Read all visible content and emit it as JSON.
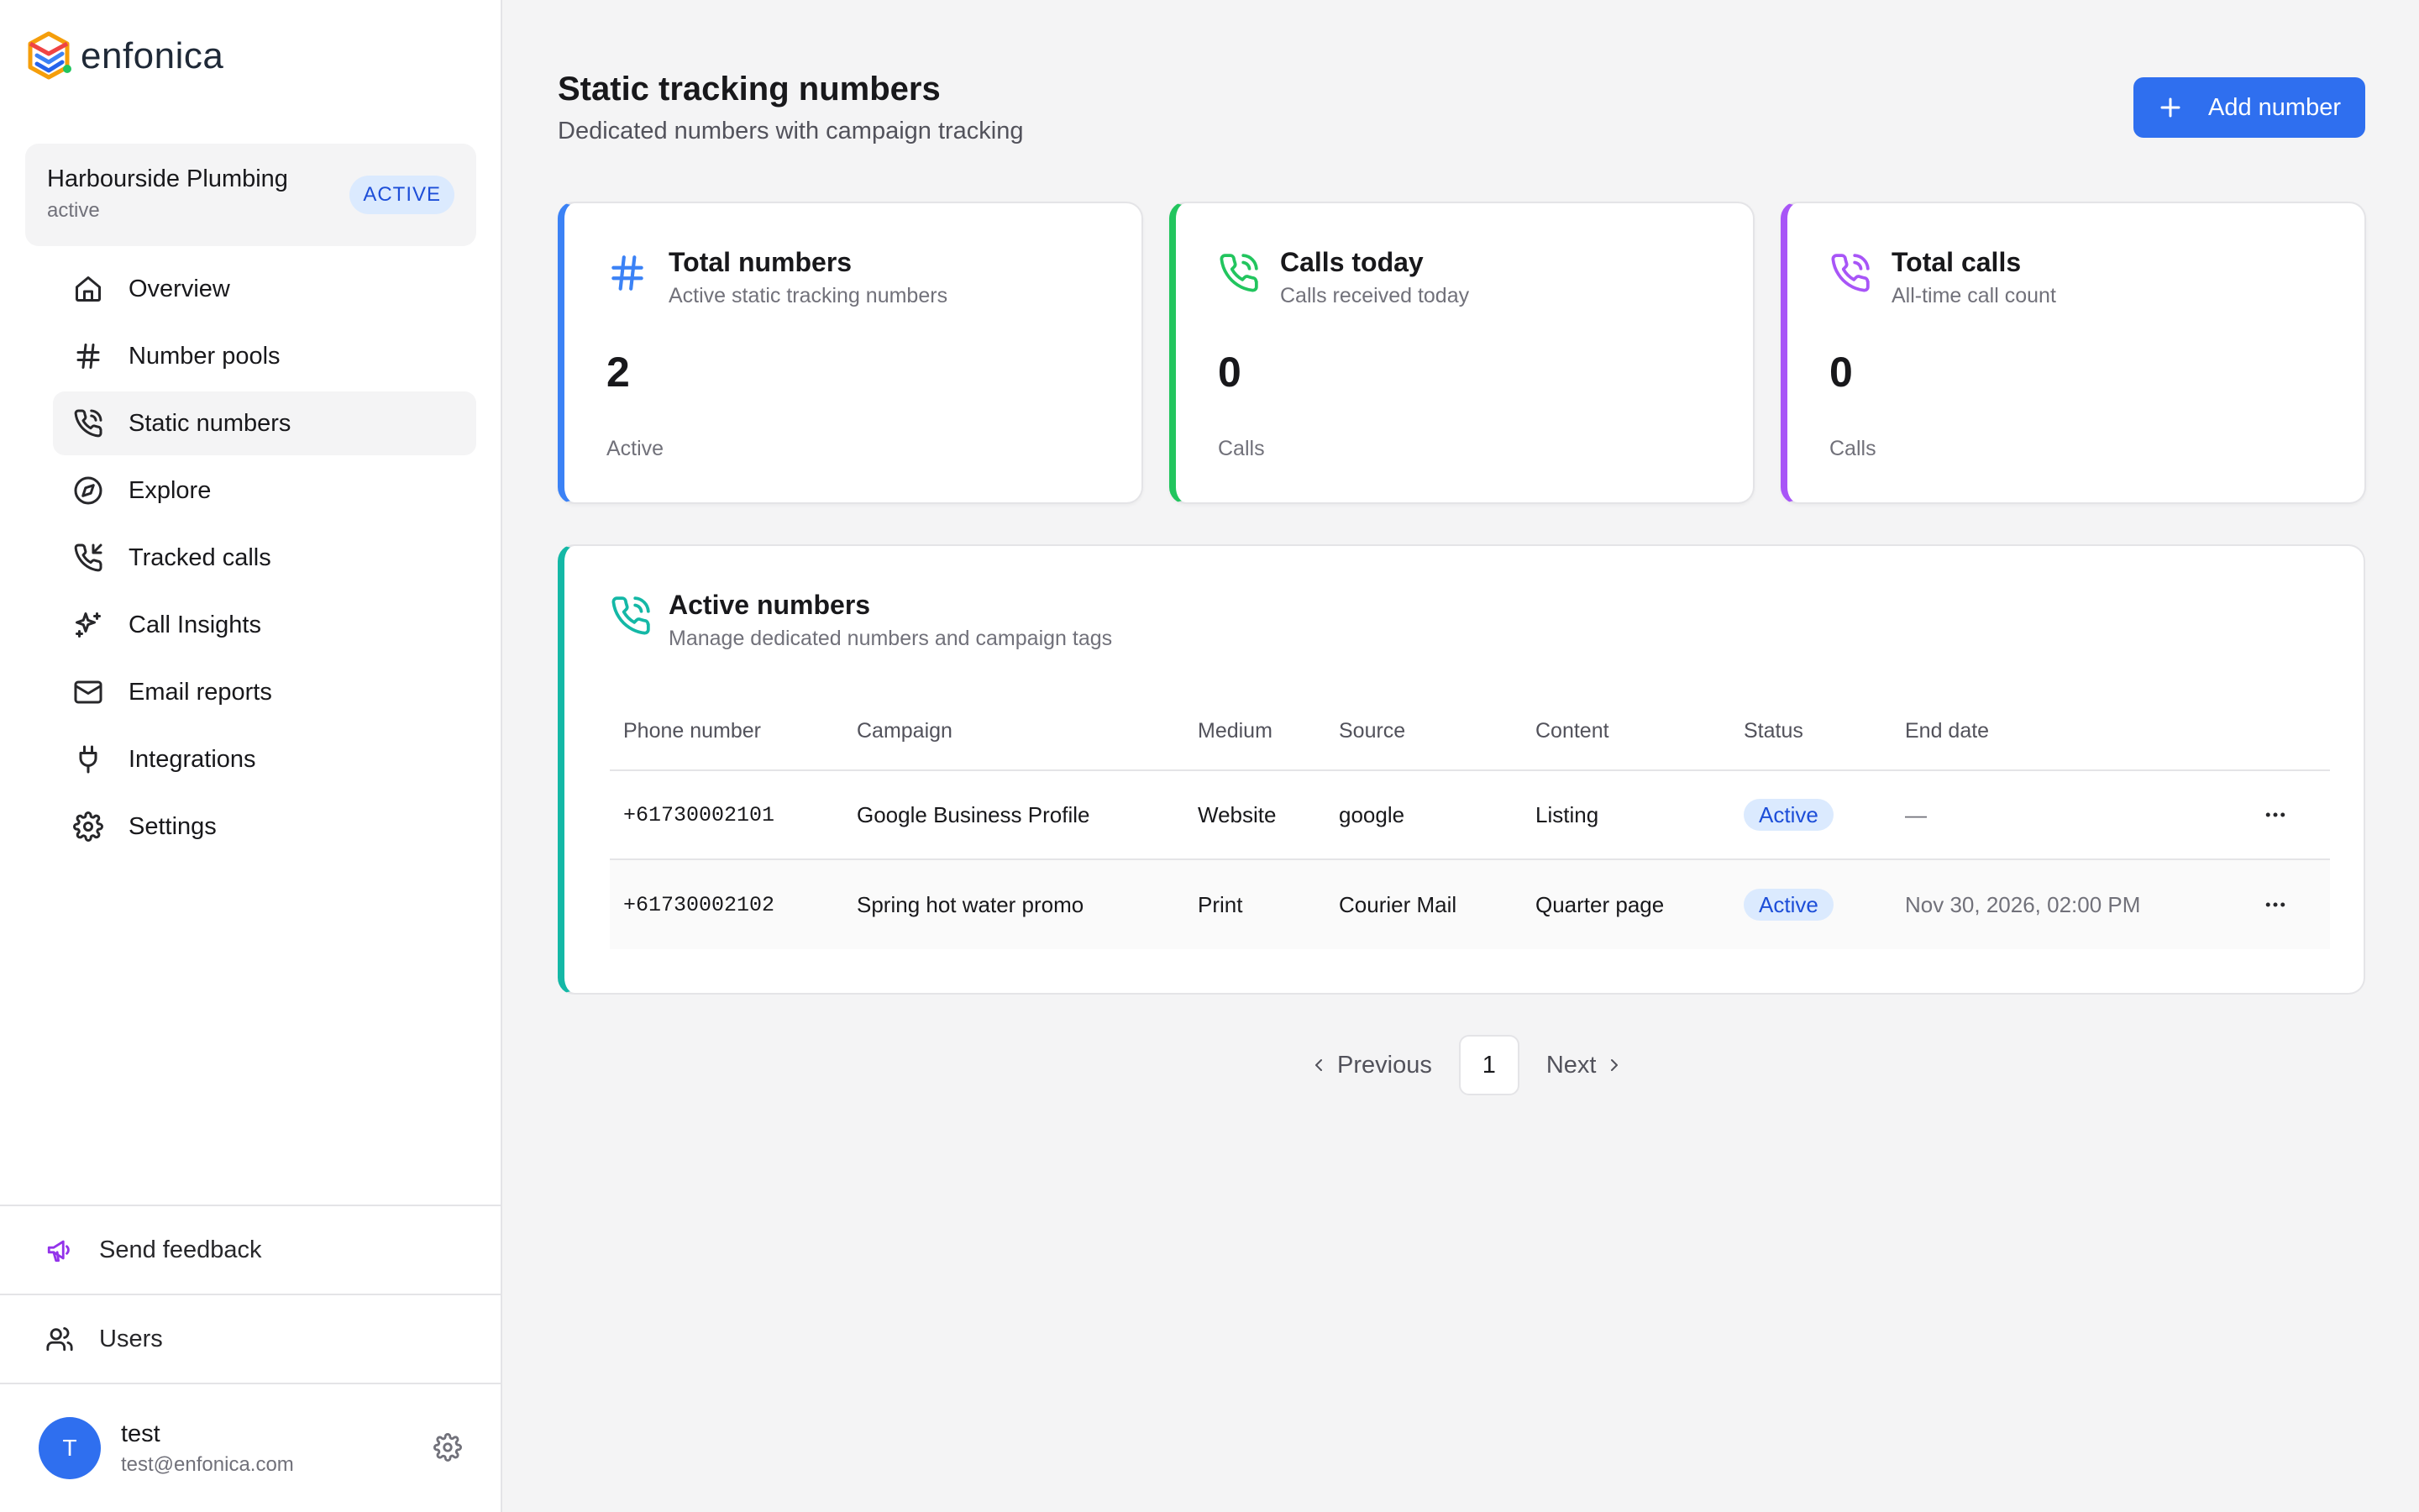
{
  "brand": {
    "name": "enfonica"
  },
  "account": {
    "name": "Harbourside Plumbing",
    "status": "active",
    "badge": "ACTIVE"
  },
  "nav": [
    {
      "label": "Overview",
      "icon": "home-icon",
      "active": false
    },
    {
      "label": "Number pools",
      "icon": "hash-icon",
      "active": false
    },
    {
      "label": "Static numbers",
      "icon": "phone-icon",
      "active": true
    },
    {
      "label": "Explore",
      "icon": "compass-icon",
      "active": false
    },
    {
      "label": "Tracked calls",
      "icon": "phone-incoming-icon",
      "active": false
    },
    {
      "label": "Call Insights",
      "icon": "sparkles-icon",
      "active": false
    },
    {
      "label": "Email reports",
      "icon": "mail-icon",
      "active": false
    },
    {
      "label": "Integrations",
      "icon": "plug-icon",
      "active": false
    },
    {
      "label": "Settings",
      "icon": "gear-icon",
      "active": false
    }
  ],
  "sidebar_bottom": {
    "feedback": "Send feedback",
    "users": "Users"
  },
  "user": {
    "initial": "T",
    "name": "test",
    "email": "test@enfonica.com"
  },
  "page": {
    "title": "Static tracking numbers",
    "subtitle": "Dedicated numbers with campaign tracking",
    "add_button": "Add number"
  },
  "stats": [
    {
      "title": "Total numbers",
      "subtitle": "Active static tracking numbers",
      "value": "2",
      "unit": "Active",
      "color": "#3b82f6",
      "icon": "hash-icon"
    },
    {
      "title": "Calls today",
      "subtitle": "Calls received today",
      "value": "0",
      "unit": "Calls",
      "color": "#22c55e",
      "icon": "phone-icon"
    },
    {
      "title": "Total calls",
      "subtitle": "All-time call count",
      "value": "0",
      "unit": "Calls",
      "color": "#a855f7",
      "icon": "phone-icon"
    }
  ],
  "active_numbers": {
    "title": "Active numbers",
    "subtitle": "Manage dedicated numbers and campaign tags",
    "columns": [
      "Phone number",
      "Campaign",
      "Medium",
      "Source",
      "Content",
      "Status",
      "End date"
    ],
    "rows": [
      {
        "phone": "+61730002101",
        "campaign": "Google Business Profile",
        "medium": "Website",
        "source": "google",
        "content": "Listing",
        "status": "Active",
        "end_date": "—"
      },
      {
        "phone": "+61730002102",
        "campaign": "Spring hot water promo",
        "medium": "Print",
        "source": "Courier Mail",
        "content": "Quarter page",
        "status": "Active",
        "end_date": "Nov 30, 2026, 02:00 PM"
      }
    ]
  },
  "pagination": {
    "previous": "Previous",
    "current": "1",
    "next": "Next"
  }
}
